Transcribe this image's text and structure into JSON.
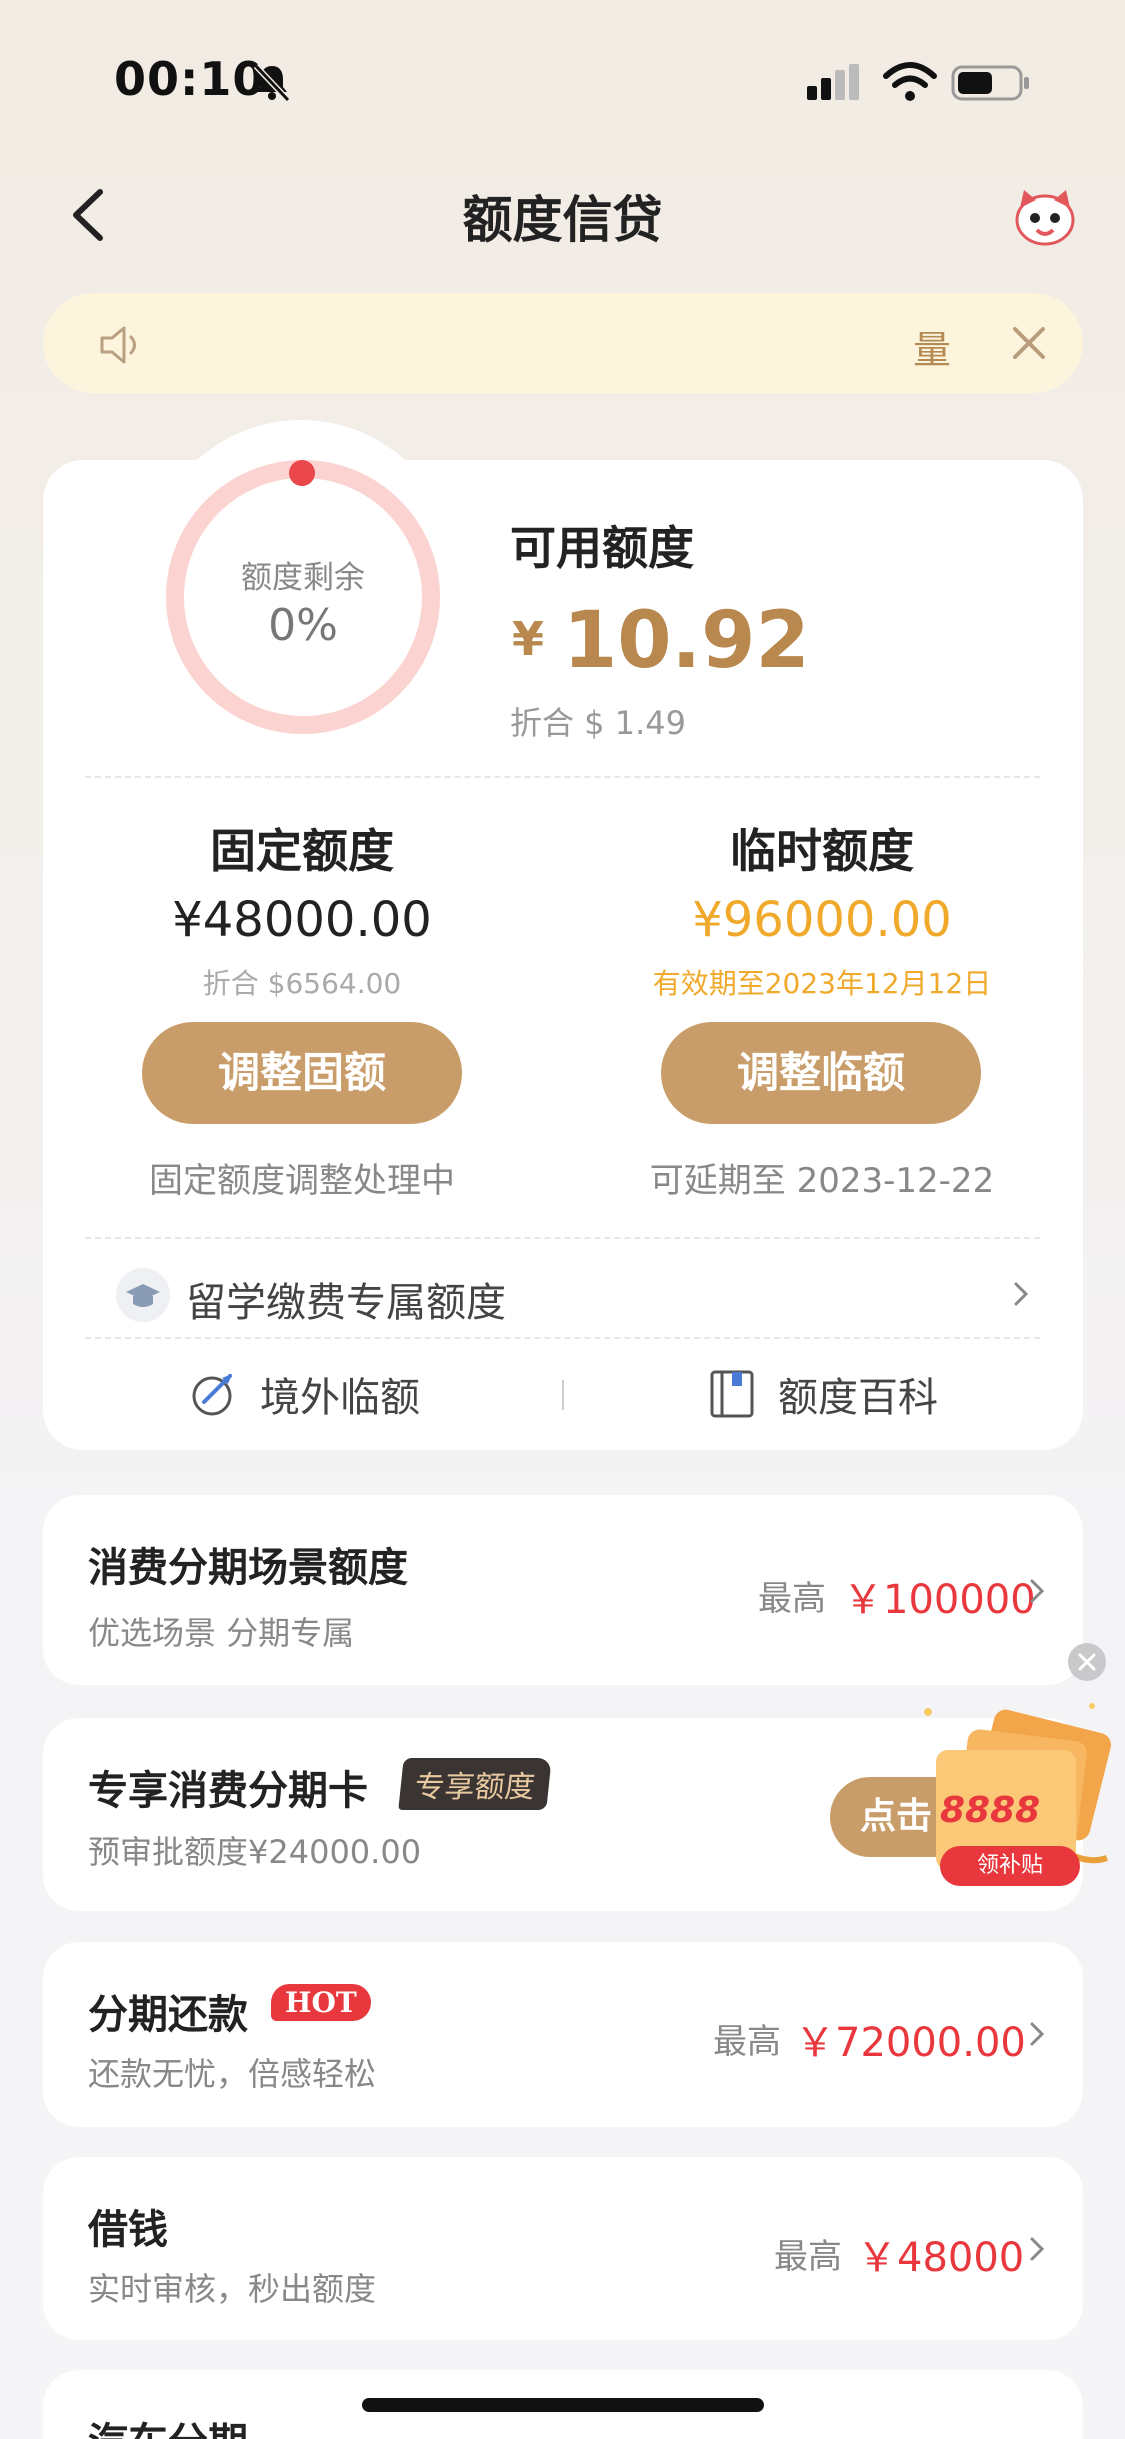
{
  "status_bar": {
    "time": "00:10"
  },
  "nav": {
    "title": "额度信贷"
  },
  "notice": {
    "text": "量"
  },
  "credit": {
    "ring_label": "额度剩余",
    "ring_percent": "0%",
    "available_label": "可用额度",
    "currency_symbol": "¥",
    "available_amount": "10.92",
    "available_usd": "折合 $ 1.49",
    "fixed": {
      "title": "固定额度",
      "amount": "¥48000.00",
      "usd": "折合 $6564.00",
      "button": "调整固额",
      "note": "固定额度调整处理中"
    },
    "temp": {
      "title": "临时额度",
      "amount": "¥96000.00",
      "validity": "有效期至2023年12月12日",
      "button": "调整临额",
      "note": "可延期至 2023-12-22"
    },
    "study_abroad": "留学缴费专属额度",
    "links": {
      "overseas": "境外临额",
      "encyclopedia": "额度百科"
    }
  },
  "cards": {
    "installment_scene": {
      "title": "消费分期场景额度",
      "sub": "优选场景 分期专属",
      "max_label": "最高",
      "max_value": "￥100000"
    },
    "exclusive_card": {
      "title": "专享消费分期卡",
      "badge": "专享额度",
      "sub": "预审批额度¥24000.00",
      "button": "点击"
    },
    "repayment": {
      "title": "分期还款",
      "badge": "HOT",
      "sub": "还款无忧，倍感轻松",
      "max_label": "最高",
      "max_value": "￥72000.00"
    },
    "borrow": {
      "title": "借钱",
      "sub": "实时审核，秒出额度",
      "max_label": "最高",
      "max_value": "￥48000"
    },
    "car": {
      "title": "汽车分期"
    }
  },
  "promo": {
    "amount": "8888",
    "tag": "领补贴"
  },
  "colors": {
    "gold": "#b8884e",
    "button": "#c99d69",
    "red": "#e8383d",
    "orange": "#f0a92a"
  }
}
